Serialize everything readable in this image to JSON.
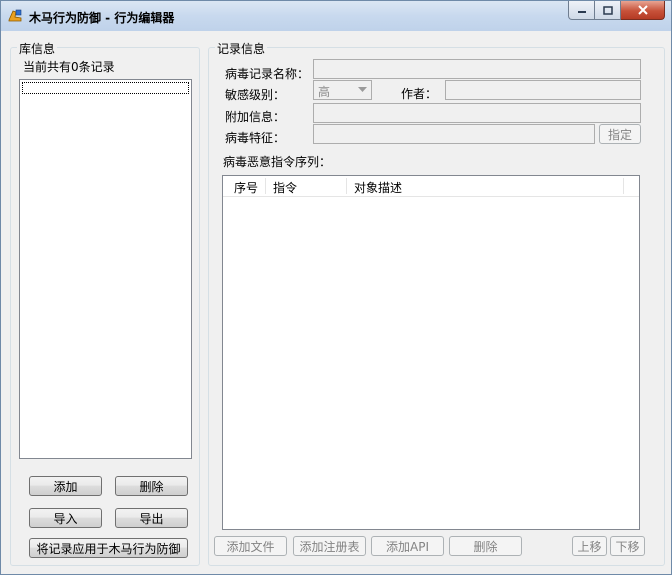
{
  "window": {
    "title": "木马行为防御 - 行为编辑器"
  },
  "library": {
    "group_title": "库信息",
    "count_text": "当前共有0条记录",
    "buttons": {
      "add": "添加",
      "delete": "删除",
      "import": "导入",
      "export": "导出",
      "apply": "将记录应用于木马行为防御"
    }
  },
  "record": {
    "group_title": "记录信息",
    "name_label": "病毒记录名称：",
    "level_label": "敏感级别：",
    "level_value": "高",
    "author_label": "作者：",
    "extra_label": "附加信息：",
    "signature_label": "病毒特征：",
    "assign_button": "指定",
    "sequence_label": "病毒恶意指令序列：",
    "columns": [
      "序号",
      "指令",
      "对象描述"
    ],
    "buttons": {
      "add_file": "添加文件",
      "add_registry": "添加注册表",
      "add_api": "添加API",
      "delete": "删除",
      "up": "上移",
      "down": "下移"
    }
  },
  "colors": {
    "title_gradient": "#c8d9ee",
    "close_button": "#c7523a"
  }
}
